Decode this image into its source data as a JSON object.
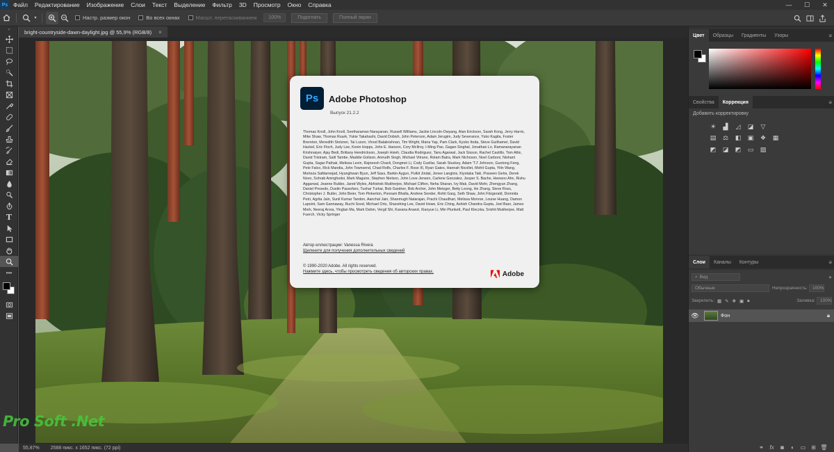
{
  "menubar": {
    "logo": "Ps",
    "items": [
      "Файл",
      "Редактирование",
      "Изображение",
      "Слои",
      "Текст",
      "Выделение",
      "Фильтр",
      "3D",
      "Просмотр",
      "Окно",
      "Справка"
    ],
    "minimize": "—",
    "maximize": "☐",
    "close": "✕"
  },
  "options": {
    "resize_windows": "Настр. размер окон",
    "all_windows": "Во всех окнах",
    "scrubby_zoom": "Масшт. перетаскиванием",
    "zoom_value": "100%",
    "fit_screen": "Подогнать",
    "fill_screen": "Полный экран"
  },
  "document": {
    "tab_title": "bright-countryside-dawn-daylight.jpg @ 55,9% (RGB/8)",
    "close": "×"
  },
  "about": {
    "logo": "Ps",
    "title": "Adobe Photoshop",
    "version": "Выпуск 21.2.2",
    "credits": "Thomas Knoll, John Knoll, Seetharaman Narayanan, Russell Williams, Jackie Lincoln-Owyang, Alan Erickson, Sarah Kong, Jerry Harris, Mike Shaw, Thomas Ruark, Yukie Takahashi, David Dobish, John Peterson, Adam Jerugim, Judy Severance, Yuko Kagita, Foster Brereton, Meredith Stotzner, Tai Luxon, Vinod Balakrishnan, Tim Wright, Maria Yap, Pam Clark, Kyoko Itoda, Steve Guilhamet, David Hackel, Eric Floch, Judy Lee, Kevin Hopps, John E. Hanson, Cory McIlroy, I-Ming Pao, Gagan Singhal, Jonathan Lo, Ramanarayanan Krishnaiyer, Ajay Bedi, Brittany Hendrickson, Joseph Hsieh, Claudia Rodriguez, Tanu Agarwal, Jack Sisson, Rachel Castillo, Tom Attix, David Tristram, Salil Tambe, Maddie Golison, Anirudh Singh, Michael Vitrano, Rolam Batra, Mark Nichoson, Noel Carboni, Nishant Gupta, Sagar Pathak, Melissa Levin, Rajneesh Chavli, Dongmei Li, Cody Cuellar, Sarah Stuckey, Adam 'TJ' Johnson, Guotong Feng, Pete Falco, Rick Mandia, John Townsend, Chad Rolfs, Charles F. Rose III, Ryan Gates, Hannah Nicollet, Mohit Gupta, Yilin Wang, Morteza Safdarnejad, Hyunghwan Byun, Jeff Sass, Barkin Aygun, Pulkit Jindal, Jenee Langlois, Kiyotaka Taki, Praveen Gelra, Derek Novo, Sohrab Amirghodsi, Mark Maguire, Stephen Nielson, John Love-Jensen, Carlene Gonzalez, Jesper S. Bache, Heewoo Ahn, Rishu Aggarwal, Jeanne Rubbo, Jared Wyles, Abhishek Mukherjee, Michael Clifton, Neha Sharan, Ivy Mak, David Mohr, Zhengyun Zhang, Daniel Presedo, Dustin Passofaro, Tushar Turkar, Bob Gardner, Bob Archer, John Metzger, Betty Leong, He Zhang, Steve Ross, Christopher J. Butler, John Beier, Tom Pinkerton, Poonam Bhalla, Andrew Sender, Rohit Garg, Seth Shaw, John Fitzgerald, Domnita Petri, Agrita Jain, Sunil Kumar Tandon, Aanchal Jain, Shanmugh Natarajan, Prachi Chaudhari, Melissa Monroe, Louise Huang, Damon Lapoint, Sam Gannaway, Ruchi Sood, Michael Orts, Shaoshing Lee, David Howe, Eric Ching, Ashish Chandra Gupta, Joel Baer, James Mork, Neeraj Arora, Yinglan Ma, Mark Dahm, Vergil Shi, Kavana Anand, Xiaoyue Li, Min Plunkett, Paul Kleczka, Srishti Mukherjee, Matt Fuerch, Vicky Springer",
    "artist": "Автор иллюстрации: Vanessa Rivera",
    "more_info": "Щелкните для получения дополнительных сведений",
    "copyright": "© 1990-2020 Adobe. All rights reserved.",
    "legal": "Нажмите здесь, чтобы просмотреть сведения об авторских правах.",
    "brand": "Adobe",
    "brand_color": "#eb1000"
  },
  "status": {
    "zoom": "55,87%",
    "doc_size": "2588 пикс. x 1652 пикс. (72 ppi)",
    "watermark": "Pro Soft .Net"
  },
  "panels": {
    "color_tabs": [
      "Цвет",
      "Образцы",
      "Градиенты",
      "Узоры"
    ],
    "adj_tabs": [
      "Свойства",
      "Коррекция"
    ],
    "adj_hint": "Добавить корректировку",
    "layers_tabs": [
      "Слои",
      "Каналы",
      "Контуры"
    ],
    "kind_filter": "Вид",
    "blend_mode": "Обычные",
    "opacity_label": "Непрозрачность:",
    "opacity_value": "100%",
    "lock_label": "Закрепить:",
    "fill_label": "Заливка:",
    "fill_value": "100%",
    "layer_name": "Фон"
  },
  "colors": {
    "accent": "#31a8ff",
    "ps_logo_bg": "#001e36",
    "ui_dark": "#323232",
    "ui_panel": "#3a3a3a"
  }
}
